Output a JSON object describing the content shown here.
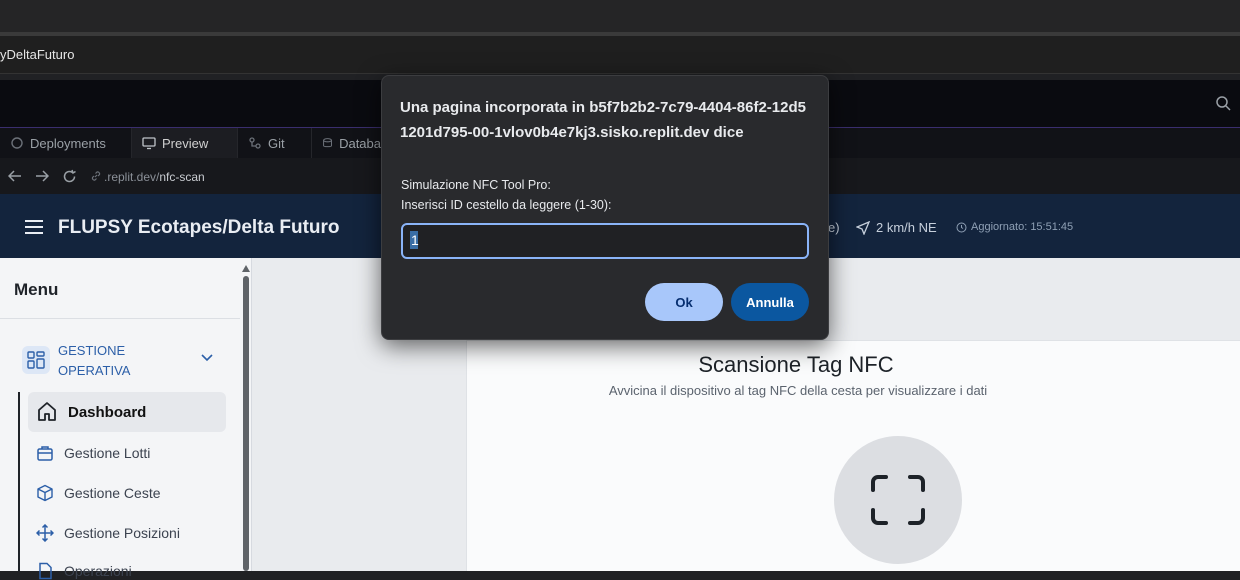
{
  "browser": {
    "tab_title": "yDeltaFuturo"
  },
  "replit": {
    "tabs": [
      {
        "label": "Deployments",
        "icon": "deployments-icon"
      },
      {
        "label": "Preview",
        "icon": "monitor-icon"
      },
      {
        "label": "Git",
        "icon": "git-icon"
      },
      {
        "label": "Databa",
        "icon": "database-icon"
      }
    ],
    "url_prefix": ".replit.dev/",
    "url_path": "nfc-scan"
  },
  "app": {
    "title": "FLUPSY Ecotapes/Delta Futuro",
    "weather_paren": "e)",
    "wind": "2 km/h NE",
    "updated": "Aggiornato: 15:51:45"
  },
  "sidebar": {
    "menu_title": "Menu",
    "group_label": "GESTIONE OPERATIVA",
    "items": [
      {
        "label": "Dashboard",
        "icon": "home-icon"
      },
      {
        "label": "Gestione Lotti",
        "icon": "briefcase-icon"
      },
      {
        "label": "Gestione Ceste",
        "icon": "box-icon"
      },
      {
        "label": "Gestione Posizioni",
        "icon": "move-icon"
      },
      {
        "label": "Operazioni",
        "icon": "file-icon"
      }
    ]
  },
  "main": {
    "scan_title": "Scansione Tag NFC",
    "scan_subtitle": "Avvicina il dispositivo al tag NFC della cesta per visualizzare i dati"
  },
  "dialog": {
    "title": "Una pagina incorporata in b5f7b2b2-7c79-4404-86f2-12d51201d795-00-1vlov0b4e7kj3.sisko.replit.dev dice",
    "message_line1": "Simulazione NFC Tool Pro:",
    "message_line2": "Inserisci ID cestello da leggere (1-30):",
    "input_value": "1",
    "ok_label": "Ok",
    "cancel_label": "Annulla"
  },
  "colors": {
    "dialog_bg": "#292a2d",
    "ok_bg": "#a8c7fa",
    "cancel_bg": "#0b57a0",
    "app_header_bg": "#13243d"
  }
}
